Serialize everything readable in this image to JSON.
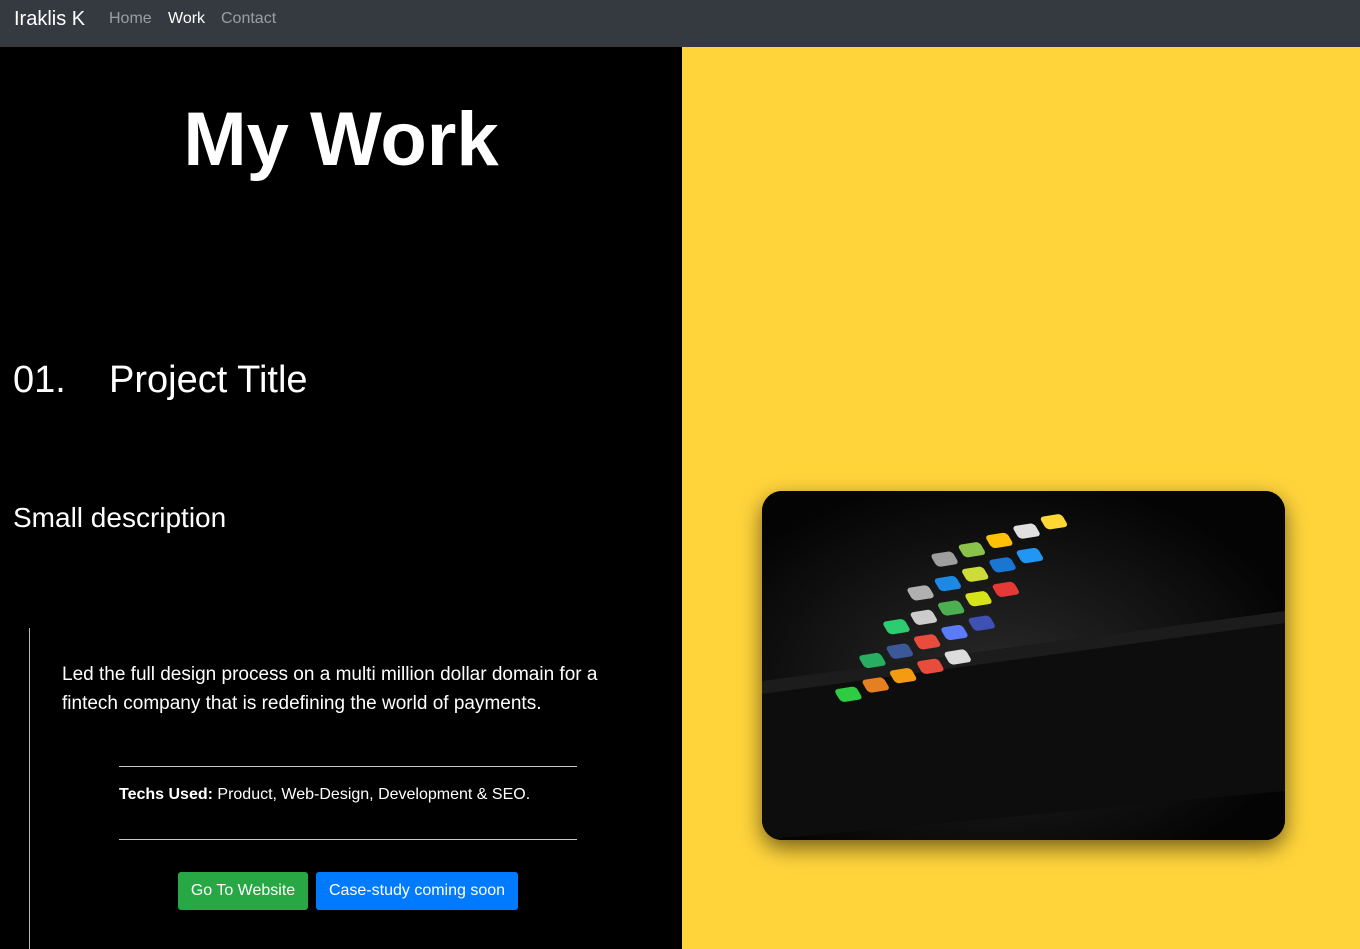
{
  "navbar": {
    "brand": "Iraklis K",
    "links": [
      {
        "label": "Home",
        "active": false
      },
      {
        "label": "Work",
        "active": true
      },
      {
        "label": "Contact",
        "active": false
      }
    ]
  },
  "main": {
    "heading": "My Work",
    "project": {
      "number": "01.",
      "title": "Project Title",
      "subtitle": "Small description",
      "description": "Led the full design process on a multi million dollar domain for a fintech company that is redefining the world of payments.",
      "techs_label": "Techs Used:",
      "techs_value": " Product, Web-Design, Development & SEO.",
      "buttons": {
        "website": "Go To Website",
        "case_study": "Case-study coming soon"
      }
    }
  },
  "image": {
    "icon": "smartphone-app-grid-icon"
  },
  "colors": {
    "navbar_bg": "#343a40",
    "left_bg": "#000000",
    "right_bg": "#ffd43b",
    "btn_success": "#28a745",
    "btn_primary": "#007bff"
  }
}
